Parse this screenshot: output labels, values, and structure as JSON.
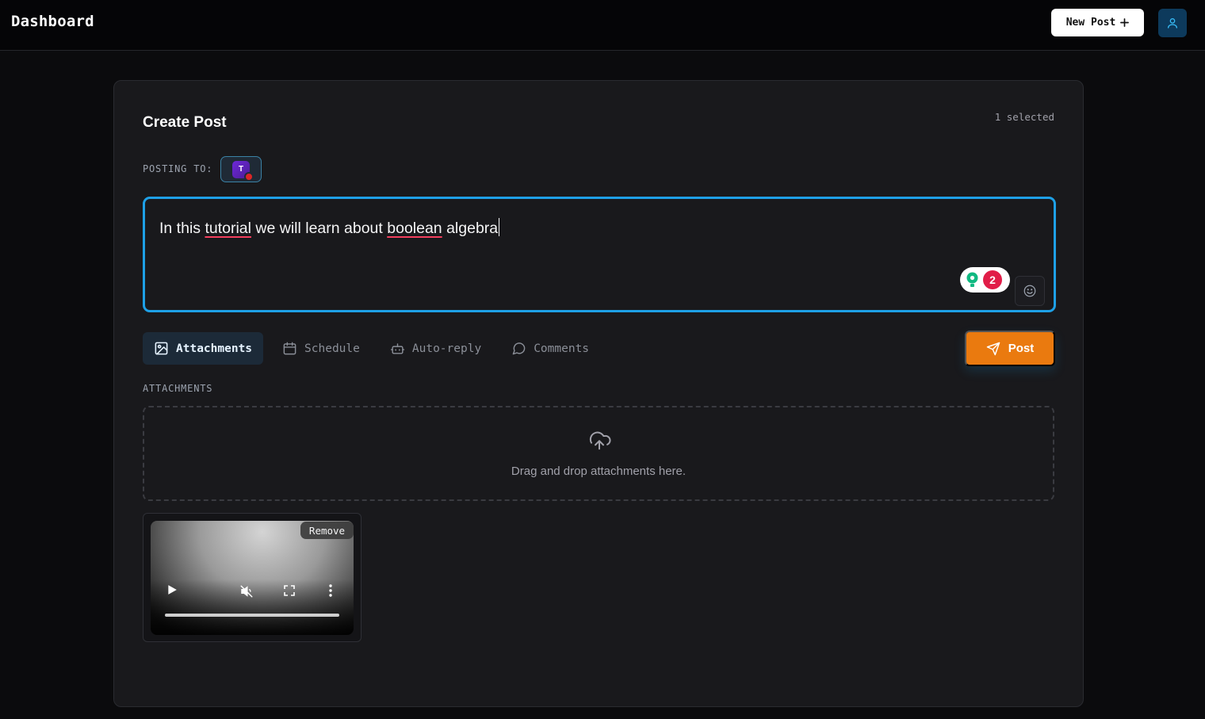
{
  "header": {
    "app_title": "Dashboard",
    "new_post_label": "New Post",
    "new_post_icon": "plus-icon",
    "profile_icon": "user-icon"
  },
  "composer": {
    "title": "Create Post",
    "selected_count": "1 selected",
    "posting_to_label": "POSTING TO:",
    "account": {
      "initial": "T",
      "platform_badge": "youtube"
    },
    "text_segments": [
      "In this ",
      "tutorial",
      " we will learn about ",
      "boolean",
      " algebra"
    ],
    "misspelled_words": [
      "tutorial",
      "boolean"
    ],
    "grammar_issue_count": "2"
  },
  "tabs": [
    {
      "label": "Attachments",
      "icon": "image-icon",
      "active": true
    },
    {
      "label": "Schedule",
      "icon": "calendar-icon",
      "active": false
    },
    {
      "label": "Auto-reply",
      "icon": "bot-icon",
      "active": false
    },
    {
      "label": "Comments",
      "icon": "message-circle-icon",
      "active": false
    }
  ],
  "actions": {
    "post_label": "Post",
    "post_icon": "send-icon"
  },
  "attachments": {
    "section_label": "ATTACHMENTS",
    "dropzone_text": "Drag and drop attachments here.",
    "dropzone_icon": "cloud-upload-icon",
    "items": [
      {
        "type": "video",
        "remove_label": "Remove",
        "muted": true
      }
    ]
  },
  "colors": {
    "accent": "#1ea0e6",
    "post_button": "#ea7a0f",
    "error": "#e11d48",
    "background": "#0b0b0d",
    "card": "#19191c"
  }
}
